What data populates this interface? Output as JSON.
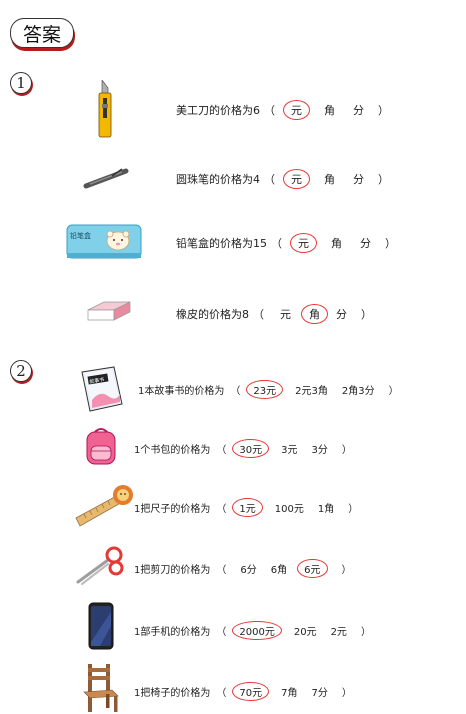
{
  "header": {
    "title": "答案"
  },
  "section1": {
    "number": "1",
    "items": [
      {
        "prefix": "美工刀的价格为6",
        "open": "（",
        "options": [
          "元",
          "角",
          "分"
        ],
        "answer_index": 0,
        "close": "）"
      },
      {
        "prefix": "圆珠笔的价格为4",
        "open": "（",
        "options": [
          "元",
          "角",
          "分"
        ],
        "answer_index": 0,
        "close": "）"
      },
      {
        "prefix": "铅笔盒的价格为15",
        "open": "（",
        "options": [
          "元",
          "角",
          "分"
        ],
        "answer_index": 0,
        "close": "）"
      },
      {
        "prefix": "橡皮的价格为8",
        "open": "（",
        "options": [
          "元",
          "角",
          "分"
        ],
        "answer_index": 1,
        "close": "）"
      }
    ],
    "pencil_box_text": "铅笔盒"
  },
  "section2": {
    "number": "2",
    "items": [
      {
        "prefix": "1本故事书的价格为",
        "open": "（",
        "options": [
          "23元",
          "2元3角",
          "2角3分"
        ],
        "answer_index": 0,
        "close": "）"
      },
      {
        "prefix": "1个书包的价格为",
        "open": "（",
        "options": [
          "30元",
          "3元",
          "3分"
        ],
        "answer_index": 0,
        "close": "）"
      },
      {
        "prefix": "1把尺子的价格为",
        "open": "（",
        "options": [
          "1元",
          "100元",
          "1角"
        ],
        "answer_index": 0,
        "close": "）"
      },
      {
        "prefix": "1把剪刀的价格为",
        "open": "（",
        "options": [
          "6分",
          "6角",
          "6元"
        ],
        "answer_index": 2,
        "close": "）"
      },
      {
        "prefix": "1部手机的价格为",
        "open": "（",
        "options": [
          "2000元",
          "20元",
          "2元"
        ],
        "answer_index": 0,
        "close": "）"
      },
      {
        "prefix": "1把椅子的价格为",
        "open": "（",
        "options": [
          "70元",
          "7角",
          "7分"
        ],
        "answer_index": 0,
        "close": "）"
      }
    ],
    "book_cover_text": "故事书"
  },
  "colors": {
    "answer_circle": "#e53935",
    "badge_shadow": "#b71c1c"
  }
}
